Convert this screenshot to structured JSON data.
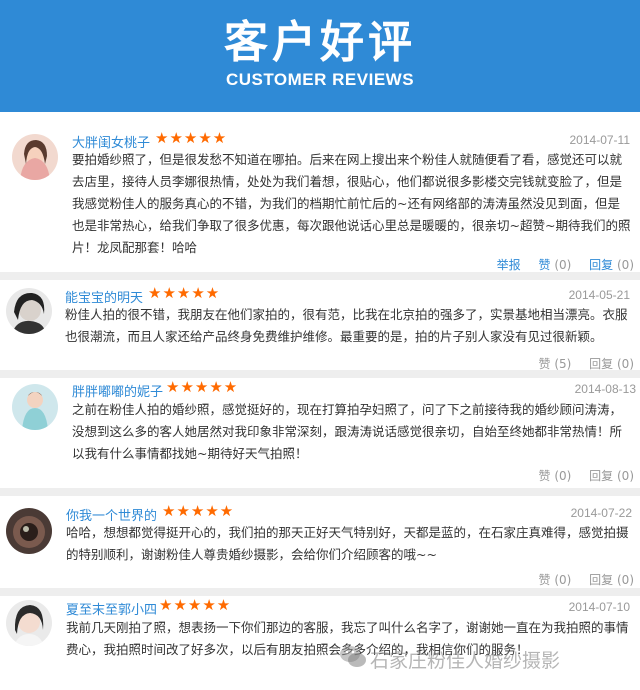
{
  "header": {
    "title": "客户好评",
    "subtitle": "CUSTOMER REVIEWS"
  },
  "stars": "★★★★★",
  "reviews": [
    {
      "name": "大胖闺女桃子",
      "date": "2014-07-11",
      "text": "要拍婚纱照了，但是很发愁不知道在哪拍。后来在网上搜出来个粉佳人就随便看了看，感觉还可以就去店里，接待人员李娜很热情，处处为我们着想，很贴心，他们都说很多影楼交完钱就变脸了，但是我感觉粉佳人的服务真心的不错，为我们的档期忙前忙后的~还有网络部的涛涛虽然没见到面，但是也是非常热心，给我们争取了很多优惠，每次跟他说话心里总是暖暖的，很亲切~超赞~期待我们的照片！龙凤配那套！哈哈",
      "report": "举报",
      "like": "赞",
      "like_count": "(0)",
      "reply": "回复",
      "reply_count": "(0)"
    },
    {
      "name": "能宝宝的明天",
      "date": "2014-05-21",
      "text": "粉佳人拍的很不错，我朋友在他们家拍的，很有范，比我在北京拍的强多了，实景基地相当漂亮。衣服也很潮流，而且人家还给产品终身免费维护维修。最重要的是，拍的片子别人家没有见过很新颖。",
      "like": "赞",
      "like_count": "(5)",
      "reply": "回复",
      "reply_count": "(0)"
    },
    {
      "name": "胖胖嘟嘟的妮子",
      "date": "2014-08-13",
      "text": "之前在粉佳人拍的婚纱照，感觉挺好的，现在打算拍孕妇照了，问了下之前接待我的婚纱顾问涛涛，没想到这么多的客人她居然对我印象非常深刻，跟涛涛说话感觉很亲切，自始至终她都非常热情！所以我有什么事情都找她~期待好天气拍照！",
      "like": "赞",
      "like_count": "(0)",
      "reply": "回复",
      "reply_count": "(0)"
    },
    {
      "name": "你我一个世界的",
      "date": "2014-07-22",
      "text": "哈哈，想想都觉得挺开心的，我们拍的那天正好天气特别好，天都是蓝的，在石家庄真难得，感觉拍摄的特别顺利，谢谢粉佳人尊贵婚纱摄影，会给你们介绍顾客的哦~~",
      "like": "赞",
      "like_count": "(0)",
      "reply": "回复",
      "reply_count": "(0)"
    },
    {
      "name": "夏至末至郭小四",
      "date": "2014-07-10",
      "text": "我前几天刚拍了照，想表扬一下你们那边的客服，我忘了叫什么名字了，谢谢她一直在为我拍照的事情费心，我拍照时间改了好多次，以后有朋友拍照会多多介绍的，我相信你们的服务！"
    }
  ],
  "watermark": "石家庄粉佳人婚纱摄影",
  "colors": {
    "banner": "#2f8ad6",
    "name": "#2f8ad6",
    "stars": "#ff6a00",
    "separator": "#eeeeee"
  }
}
